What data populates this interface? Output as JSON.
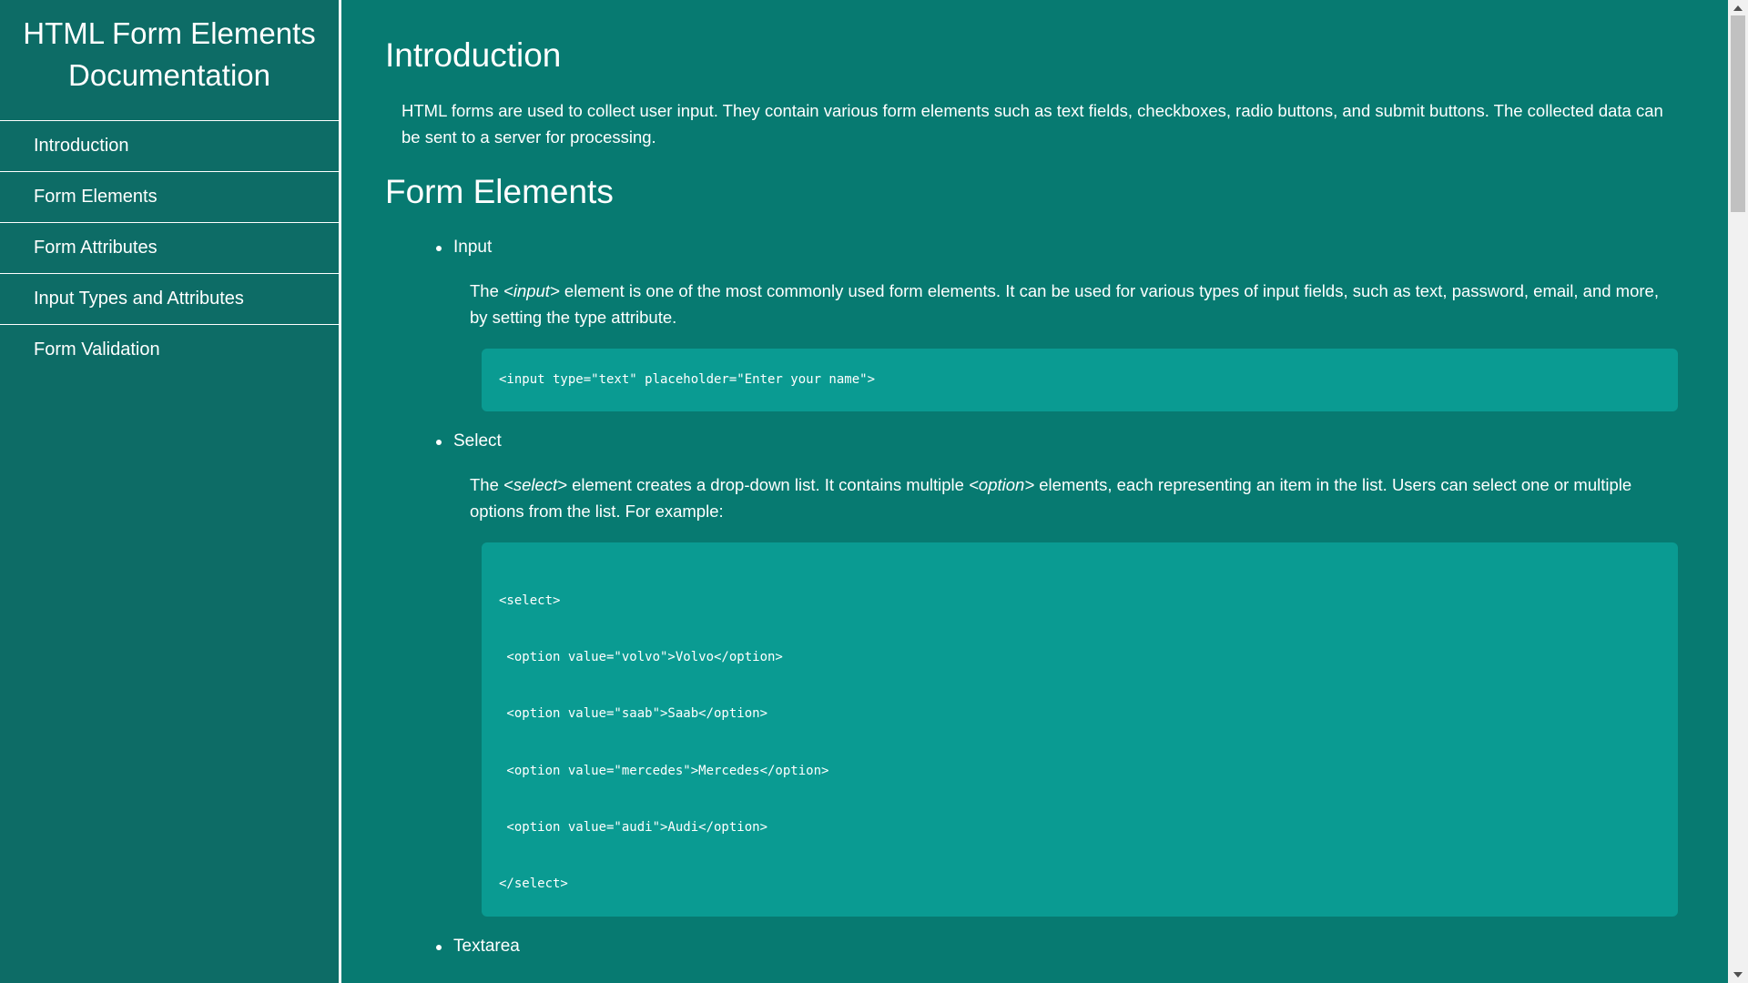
{
  "sidebar": {
    "title": "HTML Form Elements Documentation",
    "nav": [
      "Introduction",
      "Form Elements",
      "Form Attributes",
      "Input Types and Attributes",
      "Form Validation"
    ]
  },
  "intro": {
    "heading": "Introduction",
    "text": "HTML forms are used to collect user input. They contain various form elements such as text fields, checkboxes, radio buttons, and submit buttons. The collected data can be sent to a server for processing."
  },
  "form_elements": {
    "heading": "Form Elements",
    "input": {
      "label": "Input",
      "desc_before": "The ",
      "desc_tag": "<input>",
      "desc_after": " element is one of the most commonly used form elements. It can be used for various types of input fields, such as text, password, email, and more, by setting the type attribute.",
      "code": "<input type=\"text\" placeholder=\"Enter your name\">"
    },
    "select": {
      "label": "Select",
      "desc_before": "The ",
      "desc_tag": "<select>",
      "desc_middle": " element creates a drop-down list. It contains multiple ",
      "desc_tag2": "<option>",
      "desc_after": " elements, each representing an item in the list. Users can select one or multiple options from the list. For example:",
      "code_lines": [
        "<select>",
        " <option value=\"volvo\">Volvo</option>",
        " <option value=\"saab\">Saab</option>",
        " <option value=\"mercedes\">Mercedes</option>",
        " <option value=\"audi\">Audi</option>",
        "</select>"
      ]
    },
    "textarea": {
      "label": "Textarea"
    }
  }
}
